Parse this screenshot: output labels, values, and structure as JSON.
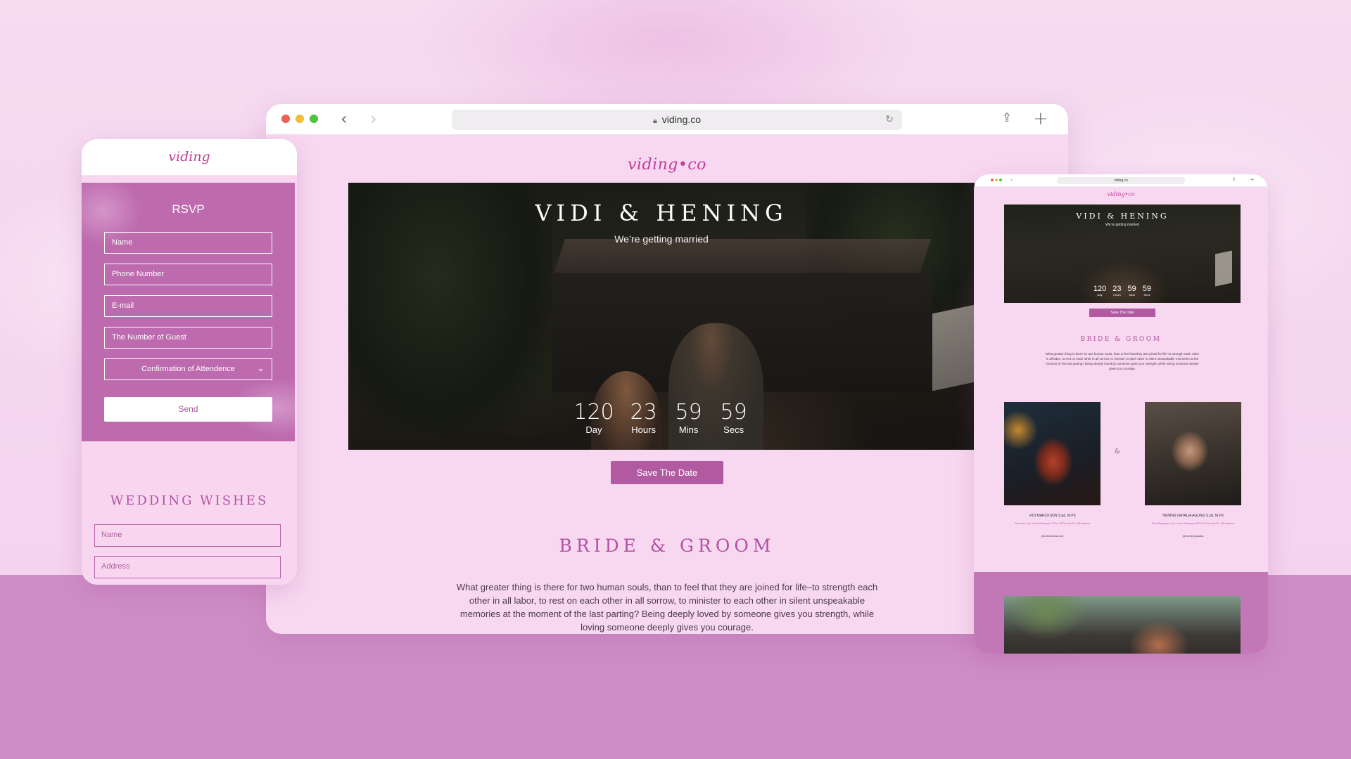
{
  "browser": {
    "url": "viding.co",
    "site_logo": "viding•co",
    "hero": {
      "title": "VIDI & HENING",
      "subtitle": "We’re getting married",
      "countdown": [
        {
          "value": "120",
          "label": "Day"
        },
        {
          "value": "23",
          "label": "Hours"
        },
        {
          "value": "59",
          "label": "Mins"
        },
        {
          "value": "59",
          "label": "Secs"
        }
      ]
    },
    "save_button": "Save The Date",
    "bride_title": "BRIDE & GROOM",
    "bride_text": "What greater thing is there for two human souls, than to feel that they are joined for life–to strength each other in all labor, to rest on each other in all sorrow, to minister to each other in silent unspeakable memories at the moment of the last parting? Being deeply loved by someone gives you strength, while loving someone deeply gives you courage."
  },
  "phone": {
    "logo": "viding",
    "rsvp": {
      "title": "RSVP",
      "fields": {
        "name": "Name",
        "phone": "Phone Number",
        "email": "E-mail",
        "guests": "The Number of Guest",
        "confirmation": "Confirmation of Attendence"
      },
      "send": "Send"
    },
    "wishes": {
      "title": "WEDDING WISHES",
      "name": "Name",
      "address": "Address"
    }
  },
  "tablet": {
    "url": "viding.co",
    "logo": "viding•co",
    "hero_title": "VIDI & HENING",
    "hero_subtitle": "We’re getting married",
    "countdown": [
      {
        "value": "120",
        "label": "Day"
      },
      {
        "value": "23",
        "label": "Hours"
      },
      {
        "value": "59",
        "label": "Mins"
      },
      {
        "value": "59",
        "label": "Secs"
      }
    ],
    "save_button": "Save The Date",
    "bride_title": "BRIDE & GROOM",
    "bride_text": "What greater thing is there for two human souls, than to feel that they are joined for life–to strength each other in all labor, to rest on each other in all sorrow, to minister to each other in silent unspeakable memories at the moment of the last parting? Being deeply loved by someone gives you strength, while loving someone deeply gives you courage.",
    "ampersand": "&",
    "groom": {
      "name": "VIDI MARCKSON S.pd, M.Pd",
      "parents": "First son of Ir. Heru Siswanto S.Pd, M.Pd and Dr. Siti Amirah",
      "instagram": "@vidimarckson12"
    },
    "bride": {
      "name": "HENING NATALIA AGUNG S.pd, M.Pd",
      "parents": "First Daughter of Ir. Heru Siswanto S.Pd, M.Pd and Dr. Siti Amirah",
      "instagram": "@henningnatalia"
    }
  },
  "colors": {
    "accent": "#b15aa2",
    "logo": "#c13d97",
    "rsvp_panel": "#bd6aae",
    "background": "#f3d2ec",
    "lower_band": "#cf8dc6"
  },
  "icons": {
    "lock": "lock-icon",
    "reload": "reload-icon",
    "share": "share-icon",
    "new_tab": "plus-icon",
    "back": "chevron-left-icon",
    "forward": "chevron-right-icon",
    "dropdown": "chevron-down-icon"
  }
}
